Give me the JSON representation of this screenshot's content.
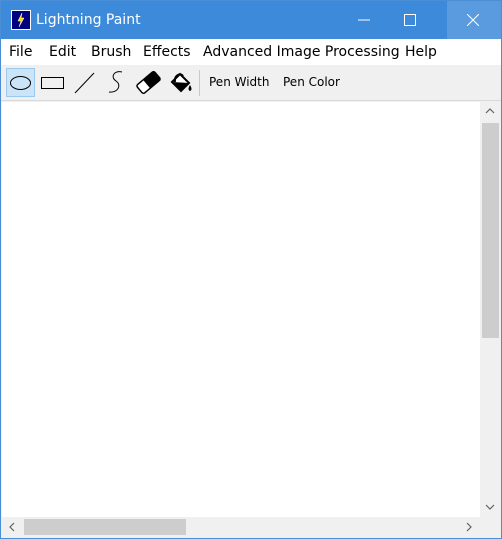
{
  "window": {
    "title": "Lightning Paint"
  },
  "menu": {
    "items": [
      "File",
      "Edit",
      "Brush",
      "Effects",
      "Advanced Image Processing",
      "Help"
    ]
  },
  "toolbar": {
    "tools": [
      {
        "name": "ellipse",
        "icon": "ellipse-icon",
        "selected": true
      },
      {
        "name": "rectangle",
        "icon": "rectangle-icon"
      },
      {
        "name": "line",
        "icon": "line-icon"
      },
      {
        "name": "freehand",
        "icon": "freehand-curve-icon"
      },
      {
        "name": "eraser",
        "icon": "eraser-icon"
      },
      {
        "name": "fill",
        "icon": "paint-bucket-icon"
      }
    ],
    "pen_width_label": "Pen Width",
    "pen_color_label": "Pen Color"
  },
  "colors": {
    "titlebar": "#3c8ad9",
    "selected_tool": "#cce4f7"
  }
}
